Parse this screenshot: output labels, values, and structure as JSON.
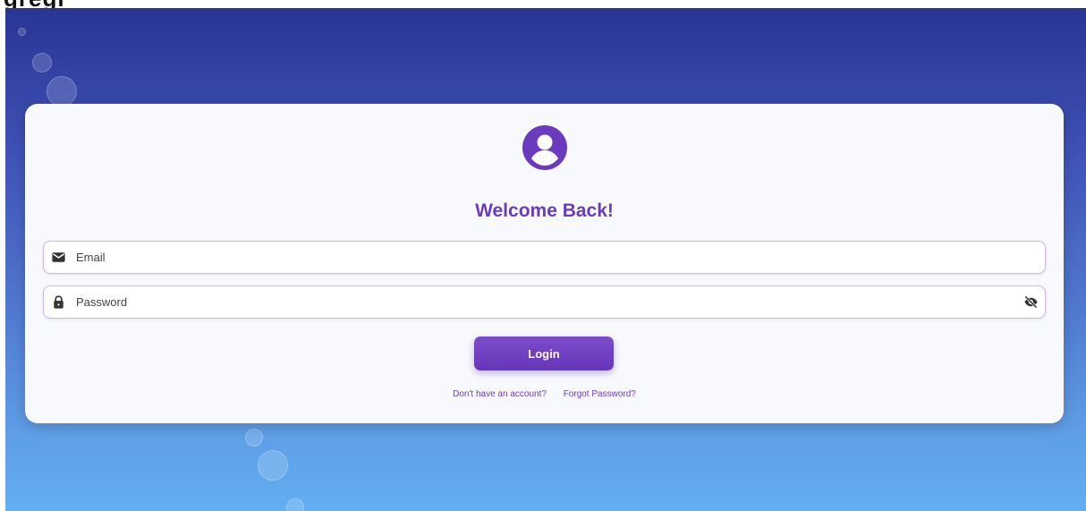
{
  "page": {
    "top_fragment": "gregr"
  },
  "login": {
    "title": "Welcome Back!",
    "email": {
      "placeholder": "Email",
      "value": "",
      "icon": "envelope-icon"
    },
    "password": {
      "placeholder": "Password",
      "value": "",
      "icon": "lock-icon",
      "toggle_icon": "eye-slash-icon"
    },
    "login_label": "Login",
    "links": {
      "signup": "Don't have an account?",
      "forgot": "Forgot Password?"
    },
    "avatar_icon": "user-circle-icon"
  },
  "colors": {
    "accent": "#6a3bbf",
    "button": "#6d3fc0",
    "gradient_top": "#2a3593",
    "gradient_bottom": "#63aef2",
    "card": "#f8f9fc"
  }
}
